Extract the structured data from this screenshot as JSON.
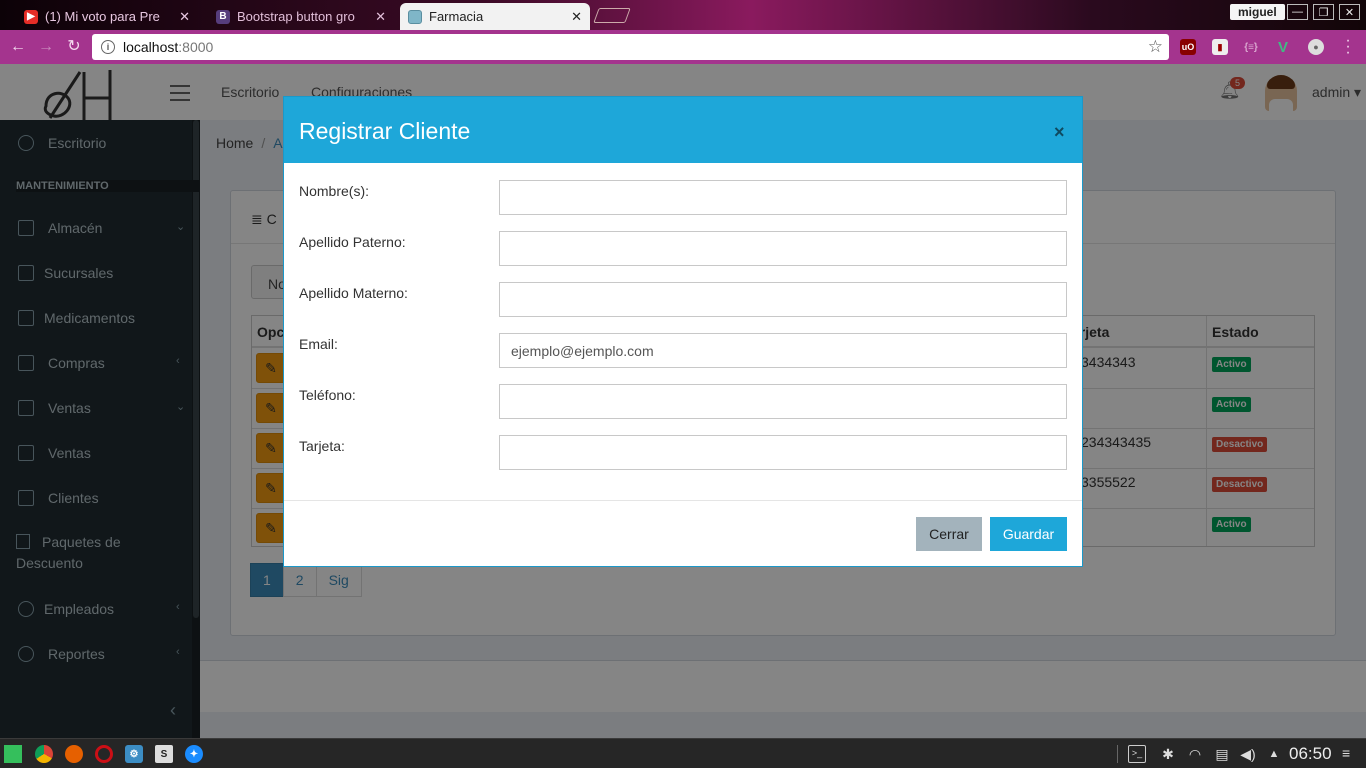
{
  "browser": {
    "tabs": [
      {
        "title": "(1) Mi voto para Pre",
        "favicon": "youtube-icon"
      },
      {
        "title": "Bootstrap button gro",
        "favicon": "bootstrap-icon"
      },
      {
        "title": "Farmacia",
        "favicon": "pharmacy-icon"
      }
    ],
    "user": "miguel",
    "url_host": "localhost",
    "url_port": ":8000"
  },
  "header": {
    "links": [
      "Escritorio",
      "Configuraciones"
    ],
    "notifications": "5",
    "user": "admin"
  },
  "sidebar": {
    "items": [
      {
        "label": "Escritorio"
      },
      {
        "label": "Almacén"
      },
      {
        "label": "Sucursales"
      },
      {
        "label": "Medicamentos"
      },
      {
        "label": "Compras"
      },
      {
        "label": "Ventas"
      },
      {
        "label": "Ventas"
      },
      {
        "label": "Clientes"
      },
      {
        "label": "Paquetes de Descuento"
      },
      {
        "label": "Empleados"
      },
      {
        "label": "Reportes"
      }
    ],
    "section": "MANTENIMIENTO"
  },
  "breadcrumb": {
    "home": "Home",
    "current": "A"
  },
  "box": {
    "title": "C",
    "tool_button": "No",
    "headers": {
      "opciones": "Opc",
      "tarjeta": "arjeta",
      "estado": "Estado"
    },
    "rows": [
      {
        "tarjeta": "3434343",
        "estado": "Activo"
      },
      {
        "tarjeta": "",
        "estado": "Activo"
      },
      {
        "tarjeta": "234343435",
        "estado": "Desactivo"
      },
      {
        "tarjeta": "3355522",
        "estado": "Desactivo"
      },
      {
        "tarjeta": "",
        "estado": "Activo"
      }
    ],
    "pagination": [
      "1",
      "2",
      "Sig"
    ]
  },
  "modal": {
    "title": "Registrar Cliente",
    "close": "×",
    "fields": [
      {
        "label": "Nombre(s):",
        "value": "",
        "placeholder": ""
      },
      {
        "label": "Apellido Paterno:",
        "value": "",
        "placeholder": ""
      },
      {
        "label": "Apellido Materno:",
        "value": "",
        "placeholder": ""
      },
      {
        "label": "Email:",
        "value": "",
        "placeholder": "ejemplo@ejemplo.com"
      },
      {
        "label": "Teléfono:",
        "value": "",
        "placeholder": ""
      },
      {
        "label": "Tarjeta:",
        "value": "",
        "placeholder": ""
      }
    ],
    "cancel_label": "Cerrar",
    "save_label": "Guardar"
  },
  "taskbar": {
    "clock": "06:50"
  },
  "colors": {
    "modal_header": "#1ea7d9",
    "sidebar": "#222d32",
    "active": "#00a65a",
    "inactive": "#dd4b39",
    "edit_button": "#f39c12"
  }
}
